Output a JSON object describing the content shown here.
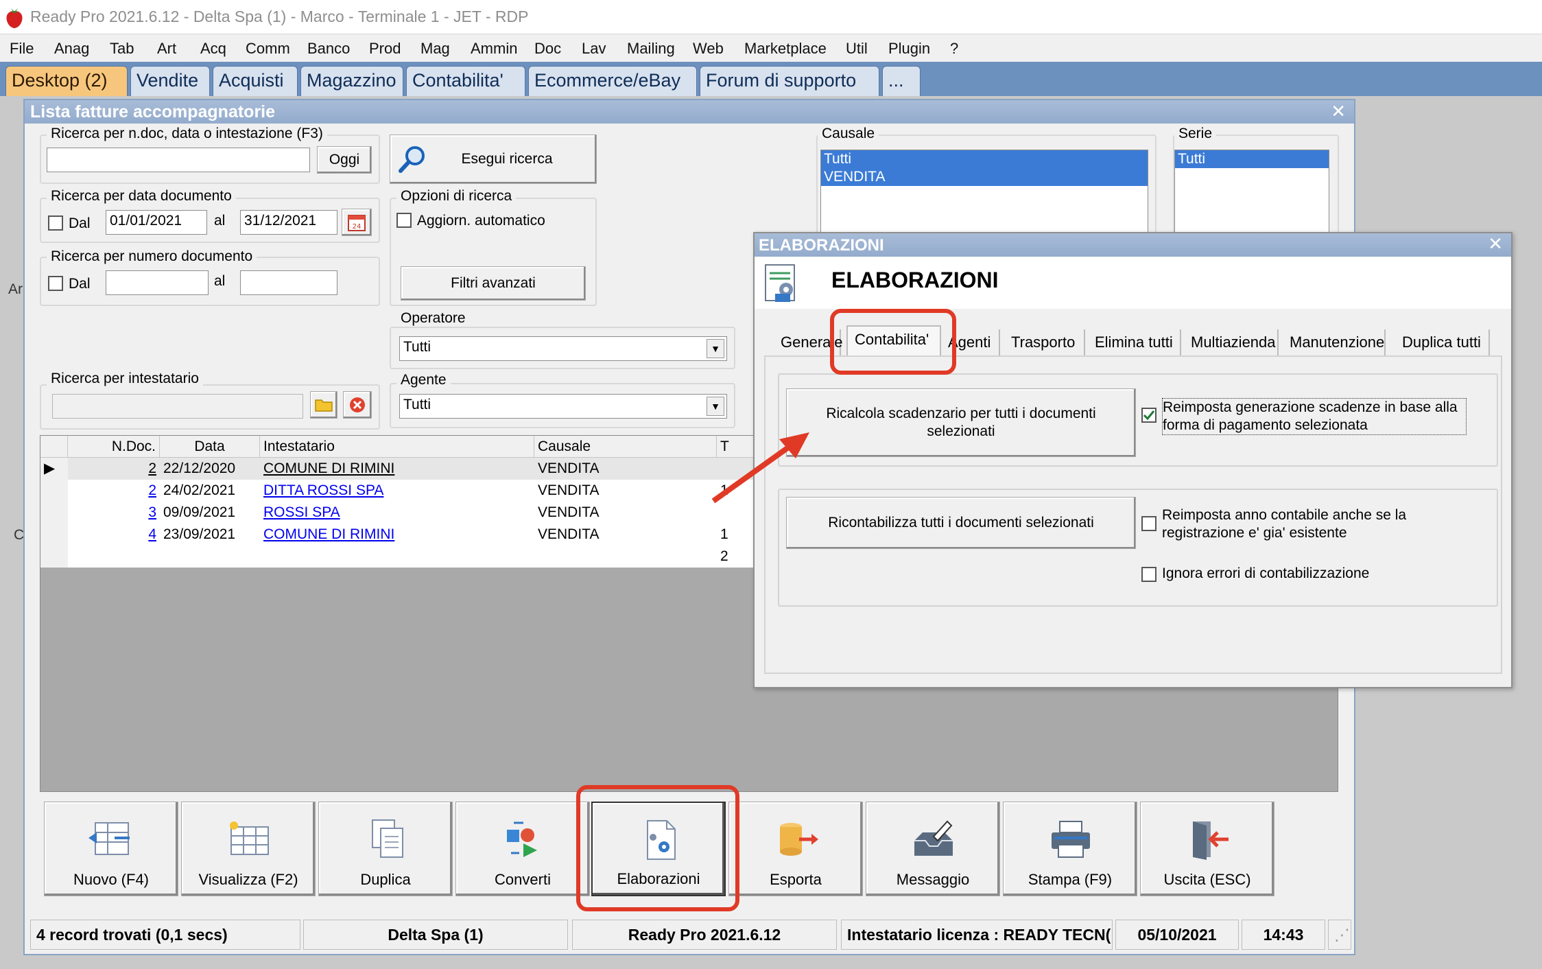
{
  "window": {
    "title": "Ready Pro 2021.6.12 - Delta Spa (1) - Marco - Terminale 1 - JET - RDP"
  },
  "menu": [
    "File",
    "Anag",
    "Tab",
    "Art",
    "Acq",
    "Comm",
    "Banco",
    "Prod",
    "Mag",
    "Ammin",
    "Doc",
    "Lav",
    "Mailing",
    "Web",
    "Marketplace",
    "Util",
    "Plugin",
    "?"
  ],
  "app_tabs": [
    "Desktop (2)",
    "Vendite",
    "Acquisti",
    "Magazzino",
    "Contabilita'",
    "Ecommerce/eBay",
    "Forum di supporto",
    "..."
  ],
  "list_window": {
    "title": "Lista fatture accompagnatorie",
    "search_label": "Ricerca per n.doc, data o intestazione (F3)",
    "search_value": "",
    "oggi_label": "Oggi",
    "run_search_label": "Esegui ricerca",
    "date_group_label": "Ricerca per data documento",
    "dal_label": "Dal",
    "al_label": "al",
    "date_from": "01/01/2021",
    "date_to": "31/12/2021",
    "num_group_label": "Ricerca per numero documento",
    "num_from": "",
    "num_to": "",
    "options_label": "Opzioni di ricerca",
    "auto_update_label": "Aggiorn. automatico",
    "advanced_filters_label": "Filtri avanzati",
    "operatore_label": "Operatore",
    "operatore_value": "Tutti",
    "agente_label": "Agente",
    "agente_value": "Tutti",
    "intestatario_label": "Ricerca per intestatario",
    "causale_label": "Causale",
    "causale_items": [
      "Tutti",
      "VENDITA"
    ],
    "serie_label": "Serie",
    "serie_items": [
      "Tutti"
    ],
    "side_letter_1": "Ar",
    "side_letter_2": "C"
  },
  "grid": {
    "columns": [
      "N.Doc.",
      "Data",
      "Intestatario",
      "Causale",
      "T"
    ],
    "rows": [
      {
        "num": "2",
        "date": "22/12/2020",
        "holder": "COMUNE DI RIMINI",
        "causale": "VENDITA",
        "t": ""
      },
      {
        "num": "2",
        "date": "24/02/2021",
        "holder": "DITTA ROSSI SPA",
        "causale": "VENDITA",
        "t": "1"
      },
      {
        "num": "3",
        "date": "09/09/2021",
        "holder": "ROSSI SPA",
        "causale": "VENDITA",
        "t": ""
      },
      {
        "num": "4",
        "date": "23/09/2021",
        "holder": "COMUNE DI RIMINI",
        "causale": "VENDITA",
        "t": "1"
      }
    ],
    "extra_row_t": "2"
  },
  "toolbar": [
    "Nuovo (F4)",
    "Visualizza (F2)",
    "Duplica",
    "Converti",
    "Elaborazioni",
    "Esporta",
    "Messaggio",
    "Stampa (F9)",
    "Uscita (ESC)"
  ],
  "status": {
    "records": "4 record trovati (0,1 secs)",
    "company": "Delta Spa (1)",
    "version": "Ready Pro 2021.6.12",
    "license": "Intestatario licenza : READY TECN(",
    "date": "05/10/2021",
    "time": "14:43"
  },
  "dialog": {
    "title": "ELABORAZIONI",
    "heading": "ELABORAZIONI",
    "tabs": [
      "Generale",
      "Contabilita'",
      "Agenti",
      "Trasporto",
      "Elimina tutti",
      "Multiazienda",
      "Manutenzione",
      "Duplica tutti"
    ],
    "active_tab": "Contabilita'",
    "recalc_button": "Ricalcola scadenzario per tutti i documenti selezionati",
    "reset_due_label": "Reimposta generazione scadenze in base alla forma di pagamento selezionata",
    "reset_due_checked": true,
    "recount_button": "Ricontabilizza tutti i documenti selezionati",
    "reset_year_label": "Reimposta anno contabile anche se la registrazione e' gia' esistente",
    "ignore_errors_label": "Ignora errori di contabilizzazione"
  },
  "colors": {
    "accent_red": "#e03a26",
    "tab_active": "#f7c67d",
    "title_blue": "#93abcd",
    "selection": "#3b7bd6"
  }
}
